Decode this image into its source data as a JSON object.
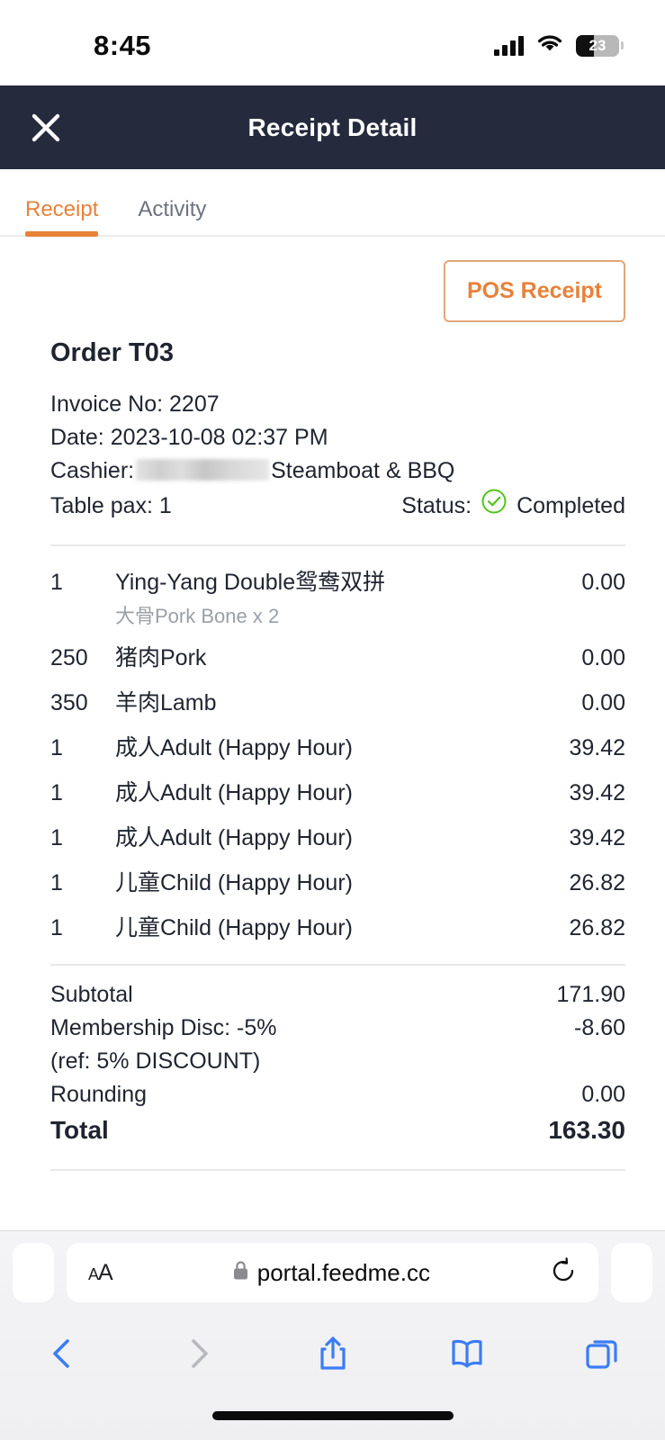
{
  "status_bar": {
    "time": "8:45",
    "battery_percent": "23",
    "icons": [
      "cellular-signal-icon",
      "wifi-icon",
      "battery-icon"
    ]
  },
  "header": {
    "title": "Receipt Detail",
    "close_icon": "close-icon"
  },
  "tabs": [
    {
      "label": "Receipt",
      "active": true
    },
    {
      "label": "Activity",
      "active": false
    }
  ],
  "actions": {
    "pos_receipt_label": "POS Receipt"
  },
  "order": {
    "title": "Order T03",
    "invoice_line": "Invoice No: 2207",
    "date_line": "Date: 2023-10-08 02:37 PM",
    "cashier_label": "Cashier:",
    "cashier_name_redacted": "",
    "cashier_store": "Steamboat & BBQ",
    "table_pax_line": "Table pax: 1",
    "status_label": "Status:",
    "status_value": "Completed",
    "status_icon": "check-circle-icon"
  },
  "items": [
    {
      "qty": "1",
      "name": "Ying-Yang Double鸳鸯双拼",
      "sub": "大骨Pork Bone x 2",
      "price": "0.00"
    },
    {
      "qty": "250",
      "name": "猪肉Pork",
      "sub": "",
      "price": "0.00"
    },
    {
      "qty": "350",
      "name": "羊肉Lamb",
      "sub": "",
      "price": "0.00"
    },
    {
      "qty": "1",
      "name": "成人Adult (Happy Hour)",
      "sub": "",
      "price": "39.42"
    },
    {
      "qty": "1",
      "name": "成人Adult (Happy Hour)",
      "sub": "",
      "price": "39.42"
    },
    {
      "qty": "1",
      "name": "成人Adult (Happy Hour)",
      "sub": "",
      "price": "39.42"
    },
    {
      "qty": "1",
      "name": "儿童Child (Happy Hour)",
      "sub": "",
      "price": "26.82"
    },
    {
      "qty": "1",
      "name": "儿童Child (Happy Hour)",
      "sub": "",
      "price": "26.82"
    }
  ],
  "totals": {
    "subtotal_label": "Subtotal",
    "subtotal_value": "171.90",
    "discount_label": "Membership Disc: -5%",
    "discount_value": "-8.60",
    "discount_ref": "(ref: 5% DISCOUNT)",
    "rounding_label": "Rounding",
    "rounding_value": "0.00",
    "total_label": "Total",
    "total_value": "163.30"
  },
  "browser": {
    "text_size_label": "AA",
    "url": "portal.feedme.cc",
    "lock_icon": "lock-icon",
    "reload_icon": "reload-icon",
    "toolbar_icons": [
      "back-icon",
      "forward-icon",
      "share-icon",
      "bookmarks-icon",
      "tabs-icon"
    ]
  },
  "colors": {
    "accent_orange": "#e8813a",
    "header_navy": "#252a3d",
    "status_green": "#52c41a",
    "browser_blue": "#3b7cf6"
  }
}
